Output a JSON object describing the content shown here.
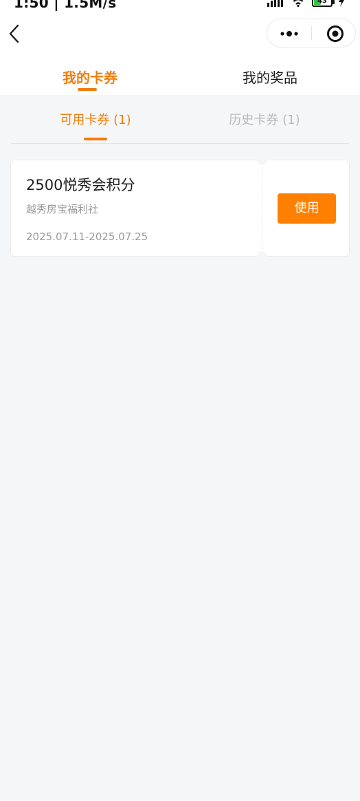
{
  "status_bar": {
    "text": "1:50 | 1.5M/s",
    "battery_level": "43",
    "battery_fraction": 0.43,
    "battery_color": "#35c24a"
  },
  "nav": {
    "back_icon": "chevron-left-icon",
    "more_icon": "more-dots-icon",
    "close_icon": "target-circle-icon"
  },
  "top_tabs": [
    {
      "label": "我的卡券",
      "active": true
    },
    {
      "label": "我的奖品",
      "active": false
    }
  ],
  "sub_tabs": [
    {
      "label": "可用卡券 (1)",
      "active": true
    },
    {
      "label": "历史卡券 (1)",
      "active": false
    }
  ],
  "coupons": [
    {
      "title": "2500悦秀会积分",
      "issuer": "越秀房宝福利社",
      "validity": "2025.07.11-2025.07.25",
      "action_label": "使用"
    }
  ],
  "colors": {
    "accent": "#f07d0c",
    "button": "#ff8000",
    "background": "#f5f6f8"
  }
}
